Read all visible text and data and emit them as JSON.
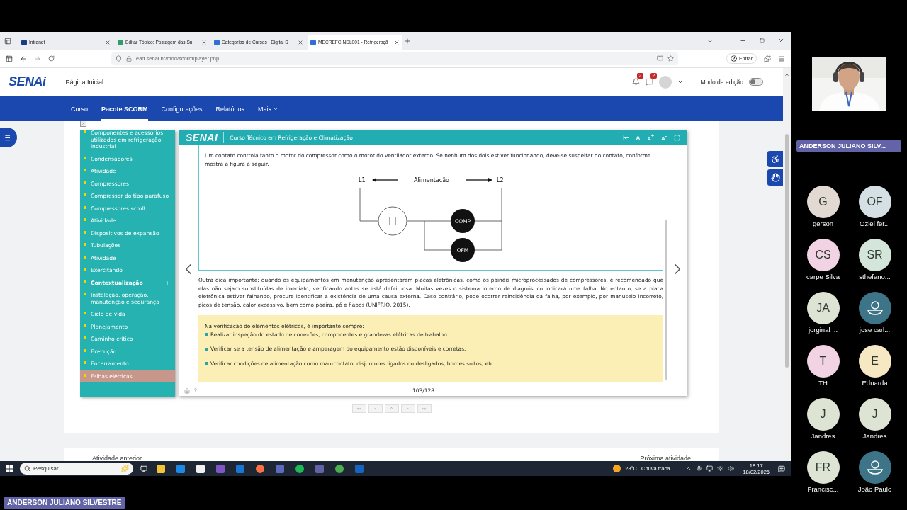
{
  "browser": {
    "tabs": [
      {
        "title": "Intranet",
        "selected": false
      },
      {
        "title": "Editar Tópico: Postagem das Su",
        "selected": false
      },
      {
        "title": "Categorias de Cursos | Digital S",
        "selected": false
      },
      {
        "title": "MECREFCINDL001 - Refrigeraçã",
        "selected": true
      }
    ],
    "url": "ead.senai.br/mod/scorm/player.php",
    "sign_in": "Entrar"
  },
  "site": {
    "logo": "SENAi",
    "home": "Página Inicial",
    "notifications": "2",
    "messages": "2",
    "edit_mode": {
      "label": "Modo de edição",
      "on": false
    },
    "nav": [
      {
        "label": "Curso",
        "selected": false
      },
      {
        "label": "Pacote SCORM",
        "selected": true
      },
      {
        "label": "Configurações",
        "selected": false
      },
      {
        "label": "Relatórios",
        "selected": false
      },
      {
        "label": "Mais",
        "selected": false
      }
    ]
  },
  "toc": {
    "toggle": ">",
    "items": [
      {
        "label": "Componentes e acessórios utilizados em refrigeração industrial",
        "kind": "topic",
        "selected": false
      },
      {
        "label": "Condensadores",
        "kind": "topic",
        "selected": false
      },
      {
        "label": "Atividade",
        "kind": "topic",
        "selected": false
      },
      {
        "label": "Compressores",
        "kind": "topic",
        "selected": false
      },
      {
        "label": "Compressor do tipo parafuso",
        "kind": "topic",
        "selected": false
      },
      {
        "label": "Compressores *scroll*",
        "kind": "topic",
        "selected": false
      },
      {
        "label": "Atividade",
        "kind": "topic",
        "selected": false
      },
      {
        "label": "Dispositivos de expansão",
        "kind": "topic",
        "selected": false
      },
      {
        "label": "Tubulações",
        "kind": "topic",
        "selected": false
      },
      {
        "label": "Atividade",
        "kind": "topic",
        "selected": false
      },
      {
        "label": "Exercitando",
        "kind": "topic",
        "selected": false
      },
      {
        "label": "Contextualização",
        "kind": "section",
        "expander": "+",
        "selected": false
      },
      {
        "label": "Instalação, operação, manutenção e segurança",
        "kind": "topic",
        "selected": false
      },
      {
        "label": "Ciclo de vida",
        "kind": "topic",
        "selected": false
      },
      {
        "label": "Planejamento",
        "kind": "topic",
        "selected": false
      },
      {
        "label": "Caminho crítico",
        "kind": "topic",
        "selected": false
      },
      {
        "label": "Execução",
        "kind": "topic",
        "selected": false
      },
      {
        "label": "Encerramento",
        "kind": "topic",
        "selected": false
      },
      {
        "label": "Falhas elétricas",
        "kind": "topic",
        "selected": true
      }
    ]
  },
  "player": {
    "logo": "SENAI",
    "course": "Curso Técnico em Refrigeração e Climatização",
    "font_controls": [
      "A",
      "A$^{+}$",
      "A$^{-}$"
    ],
    "intro": "Um contato controla tanto o motor do compressor como o motor do ventilador externo. Se nenhum dos dois estiver funcionando, deve-se suspeitar do contato, conforme mostra a figura a seguir.",
    "diagram": {
      "left": "L1",
      "center": "Alimentação",
      "right": "L2",
      "motors": [
        "COMP",
        "OFM"
      ]
    },
    "paragraph": "Outra dica importante: quando os equipamentos em manutenção apresentarem placas eletrônicas, como os painéis microprocessados de compressores, é recomendado que elas não sejam substituídas de imediato, verificando antes se está defeituosa. Muitas vezes o sistema interno de diagnóstico indicará uma falha. No entanto, se a placa eletrônica estiver falhando, procure identificar a existência de uma causa externa. Caso contrário, pode ocorrer reincidência da falha, por exemplo, por manuseio incorreto, picos de tensão, calor excessivo, bem como poeira, pó e fiapos (UNIFRIO, 2015).",
    "callout": {
      "title": "Na verificação de elementos elétricos, é importante sempre:",
      "items": [
        "Realizar inspeção do estado de conexões, componentes e grandezas elétricas de trabalho.",
        "Verificar se a tensão de alimentação e amperagem do equipamento estão disponíveis e corretas.",
        "Verificar condições de alimentação como mau-contato, disjuntores ligados ou desligados, bornes soltos, etc."
      ]
    },
    "help": "?",
    "page": "103/128",
    "pager": [
      "<<",
      "<",
      "^",
      ">",
      ">>"
    ]
  },
  "activity_nav": {
    "previous": "Atividade anterior",
    "next": "Próxima atividade"
  },
  "taskbar": {
    "search": "Pesquisar",
    "temperature": "28°C",
    "weather": "Chuva fraca",
    "time": "18:17",
    "date": "18/02/2026"
  },
  "meeting": {
    "presenter": "ANDERSON JULIANO SILV...",
    "sharer": "ANDERSON JULIANO SILVESTRE",
    "participants": [
      {
        "initials": "G",
        "name": "gerson",
        "kind": "initials",
        "color": "#e3d9d3"
      },
      {
        "initials": "OF",
        "name": "Oziel fer...",
        "kind": "initials",
        "color": "#d4e0e4"
      },
      {
        "initials": "CS",
        "name": "carpe Silva",
        "kind": "initials",
        "color": "#f2d3e3"
      },
      {
        "initials": "SR",
        "name": "sthefano...",
        "kind": "initials",
        "color": "#d4e6da"
      },
      {
        "initials": "JA",
        "name": "jorginal ...",
        "kind": "initials",
        "color": "#dde4d4"
      },
      {
        "name": "jose carl...",
        "kind": "silhouette",
        "color": "#3e7487"
      },
      {
        "initials": "T",
        "name": "TH",
        "kind": "initials",
        "color": "#f2d3e3"
      },
      {
        "initials": "E",
        "name": "Eduarda",
        "kind": "initials",
        "color": "#f6e8c2"
      },
      {
        "initials": "J",
        "name": "Jandres",
        "kind": "initials",
        "color": "#dde4d4"
      },
      {
        "initials": "J",
        "name": "Jandres",
        "kind": "initials",
        "color": "#dde4d4"
      },
      {
        "initials": "FR",
        "name": "Francisc...",
        "kind": "initials",
        "color": "#dde4d4"
      },
      {
        "name": "João Paulo",
        "kind": "silhouette",
        "color": "#3e7487"
      }
    ]
  }
}
